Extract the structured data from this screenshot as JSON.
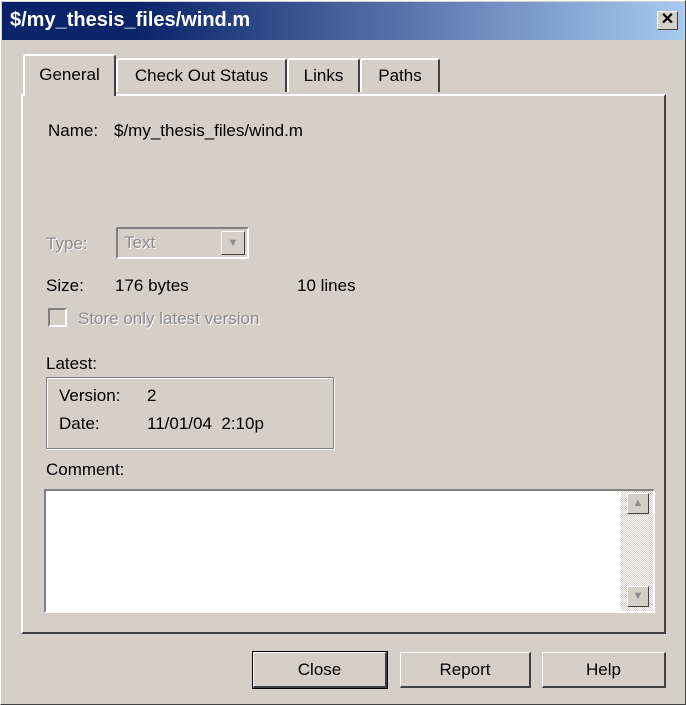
{
  "window": {
    "title": "$/my_thesis_files/wind.m",
    "close_glyph": "✕"
  },
  "tabs": [
    {
      "label": "General",
      "active": true
    },
    {
      "label": "Check Out Status",
      "active": false
    },
    {
      "label": "Links",
      "active": false
    },
    {
      "label": "Paths",
      "active": false
    }
  ],
  "general": {
    "name_label": "Name:",
    "name_value": "$/my_thesis_files/wind.m",
    "type_label": "Type:",
    "type_value": "Text",
    "size_label": "Size:",
    "size_bytes": "176 bytes",
    "size_lines": "10 lines",
    "store_latest_label": "Store only latest version",
    "store_latest_checked": false,
    "latest_label": "Latest:",
    "version_label": "Version:",
    "version_value": "2",
    "date_label": "Date:",
    "date_value": "11/01/04  2:10p",
    "comment_label": "Comment:",
    "comment_value": ""
  },
  "buttons": {
    "close": "Close",
    "report": "Report",
    "help": "Help"
  },
  "icons": {
    "combo_arrow": "chevron-down-icon",
    "scroll_up": "scroll-up-icon",
    "scroll_down": "scroll-down-icon"
  },
  "colors": {
    "titlebar_start": "#0a246a",
    "titlebar_end": "#a6caf0",
    "face": "#d4d0c8"
  }
}
